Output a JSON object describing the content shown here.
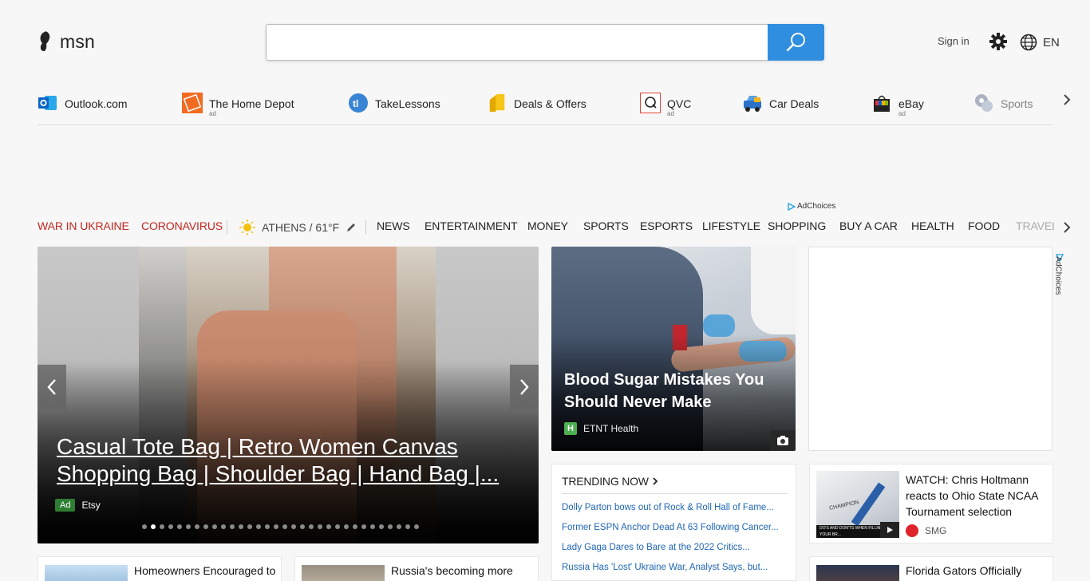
{
  "header": {
    "logo_text": "msn",
    "search_placeholder": "",
    "signin_label": "Sign in",
    "language_label": "EN"
  },
  "quicklinks": {
    "items": [
      {
        "label": "Outlook.com",
        "ad": "",
        "icon": "outlook-icon"
      },
      {
        "label": "The Home Depot",
        "ad": "ad",
        "icon": "home-depot-icon"
      },
      {
        "label": "TakeLessons",
        "ad": "",
        "icon": "takelessons-icon"
      },
      {
        "label": "Deals & Offers",
        "ad": "",
        "icon": "tag-icon"
      },
      {
        "label": "QVC",
        "ad": "ad",
        "icon": "qvc-icon"
      },
      {
        "label": "Car Deals",
        "ad": "",
        "icon": "car-icon"
      },
      {
        "label": "eBay",
        "ad": "ad",
        "icon": "ebay-icon"
      },
      {
        "label": "Sports",
        "ad": "",
        "icon": "sports-icon"
      }
    ],
    "next_icon": "chevron-right-icon"
  },
  "adchoices": {
    "label": "AdChoices"
  },
  "nav": {
    "highlights": [
      "WAR IN UKRAINE",
      "CORONAVIRUS"
    ],
    "weather": "ATHENS / 61°F",
    "items": [
      "NEWS",
      "ENTERTAINMENT",
      "MONEY",
      "SPORTS",
      "ESPORTS",
      "LIFESTYLE",
      "SHOPPING",
      "BUY A CAR",
      "HEALTH",
      "FOOD",
      "TRAVEL"
    ]
  },
  "hero": {
    "title": "Casual Tote Bag | Retro Women Canvas Shopping Bag | Shoulder Bag | Hand Bag |...",
    "ad_label": "Ad",
    "source": "Etsy",
    "active_slide": 2,
    "slide_count": 32
  },
  "medical": {
    "title": "Blood Sugar Mistakes You Should Never Make",
    "source": "ETNT Health",
    "source_initial": "H"
  },
  "trending": {
    "heading": "TRENDING NOW",
    "items": [
      "Dolly Parton bows out of Rock & Roll Hall of Fame...",
      "Former ESPN Anchor Dead At 63 Following Cancer...",
      "Lady Gaga Dares to Bare at the 2022 Critics...",
      "Russia Has 'Lost' Ukraine War, Analyst Says, but..."
    ]
  },
  "video": {
    "title": "WATCH: Chris Holtmann reacts to Ohio State NCAA Tournament selection",
    "source": "SMG",
    "thumb_caption": "DO'S AND DON'TS WHEN FILLING OUT YOUR BR...",
    "thumb_word": "CHAMPION"
  },
  "bottom": {
    "cards": [
      {
        "title": "Homeowners Encouraged to"
      },
      {
        "title": "Russia's becoming more"
      },
      {
        "title": "Florida Gators Officially"
      }
    ]
  },
  "colors": {
    "accent_blue": "#2f8ee0",
    "highlight_red": "#c0271f",
    "link_blue": "#1f66b3"
  }
}
